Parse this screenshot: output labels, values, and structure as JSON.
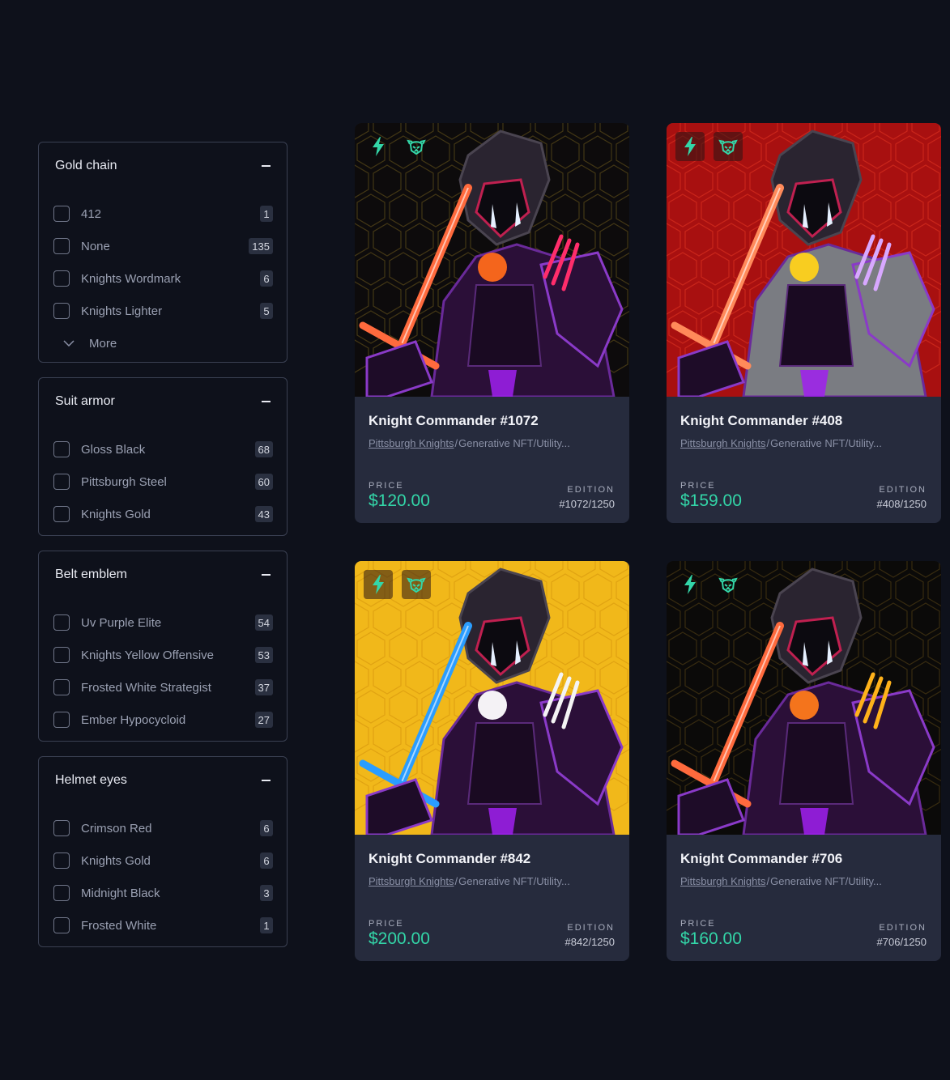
{
  "filters": [
    {
      "title": "Gold chain",
      "options": [
        {
          "label": "412",
          "count": "1"
        },
        {
          "label": "None",
          "count": "135"
        },
        {
          "label": "Knights Wordmark",
          "count": "6"
        },
        {
          "label": "Knights Lighter",
          "count": "5"
        }
      ],
      "more_label": "More"
    },
    {
      "title": "Suit armor",
      "options": [
        {
          "label": "Gloss Black",
          "count": "68"
        },
        {
          "label": "Pittsburgh Steel",
          "count": "60"
        },
        {
          "label": "Knights Gold",
          "count": "43"
        }
      ]
    },
    {
      "title": "Belt emblem",
      "options": [
        {
          "label": "Uv Purple Elite",
          "count": "54"
        },
        {
          "label": "Knights Yellow Offensive",
          "count": "53"
        },
        {
          "label": "Frosted White Strategist",
          "count": "37"
        },
        {
          "label": "Ember Hypocycloid",
          "count": "27"
        }
      ]
    },
    {
      "title": "Helmet eyes",
      "options": [
        {
          "label": "Crimson Red",
          "count": "6"
        },
        {
          "label": "Knights Gold",
          "count": "6"
        },
        {
          "label": "Midnight Black",
          "count": "3"
        },
        {
          "label": "Frosted White",
          "count": "1"
        }
      ]
    }
  ],
  "cards": [
    {
      "title": "Knight Commander #1072",
      "collection": "Pittsburgh Knights",
      "separator": "/",
      "category": "Generative NFT/Utility...",
      "price_label": "PRICE",
      "price": "$120.00",
      "edition_label": "EDITION",
      "edition": "#1072/1250",
      "background_color": "#0d0b0c",
      "pattern_color": "#5a4a1a",
      "armor_color": "#2b0f38",
      "emblem_color": "#ff6a1a",
      "claw_color": "#ff2d6b",
      "sword_color": "#ff6a3d",
      "icons": [
        "lightning-icon",
        "knight-helmet-icon"
      ]
    },
    {
      "title": "Knight Commander #408",
      "collection": "Pittsburgh Knights",
      "separator": "/",
      "category": "Generative NFT/Utility...",
      "price_label": "PRICE",
      "price": "$159.00",
      "edition_label": "EDITION",
      "edition": "#408/1250",
      "background_color": "#a81010",
      "pattern_color": "#d83020",
      "armor_color": "#7a7c82",
      "emblem_color": "#ffd21a",
      "claw_color": "#d8a8ff",
      "sword_color": "#ff8a5a",
      "icons": [
        "lightning-icon",
        "knight-helmet-icon"
      ]
    },
    {
      "title": "Knight Commander #842",
      "collection": "Pittsburgh Knights",
      "separator": "/",
      "category": "Generative NFT/Utility...",
      "price_label": "PRICE",
      "price": "$200.00",
      "edition_label": "EDITION",
      "edition": "#842/1250",
      "background_color": "#f1b81a",
      "pattern_color": "#d99a10",
      "armor_color": "#2b0f38",
      "emblem_color": "#ffffff",
      "claw_color": "#f4f4f4",
      "sword_color": "#2a9dff",
      "icons": [
        "lightning-icon",
        "knight-helmet-icon"
      ]
    },
    {
      "title": "Knight Commander #706",
      "collection": "Pittsburgh Knights",
      "separator": "/",
      "category": "Generative NFT/Utility...",
      "price_label": "PRICE",
      "price": "$160.00",
      "edition_label": "EDITION",
      "edition": "#706/1250",
      "background_color": "#0b0a09",
      "pattern_color": "#4a3a14",
      "armor_color": "#2b0f38",
      "emblem_color": "#ff7a1a",
      "claw_color": "#ffb21a",
      "sword_color": "#ff6a3d",
      "icons": [
        "lightning-icon",
        "knight-helmet-icon"
      ]
    }
  ],
  "colors": {
    "accent": "#33d6a8",
    "panel_bg": "#262b3d",
    "page_bg": "#0e111b"
  }
}
